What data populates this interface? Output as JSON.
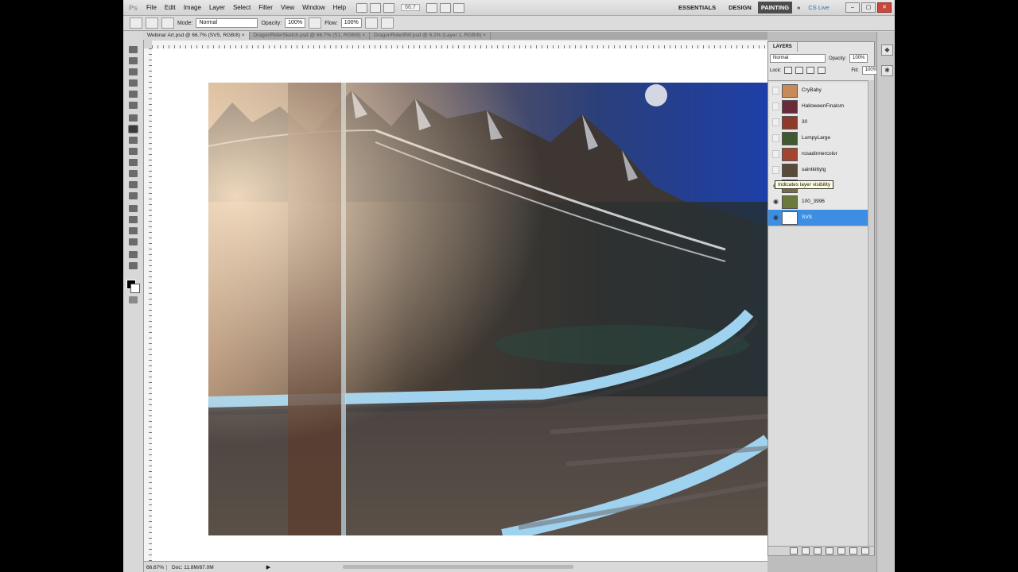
{
  "app": {
    "logo": "Ps"
  },
  "menubar": {
    "items": [
      "File",
      "Edit",
      "Image",
      "Layer",
      "Select",
      "Filter",
      "View",
      "Window",
      "Help"
    ],
    "zoom": "66.7",
    "workspaces": [
      "ESSENTIALS",
      "DESIGN",
      "PAINTING"
    ],
    "active_workspace": "PAINTING",
    "more": "»",
    "cs_live": "CS Live"
  },
  "options_bar": {
    "mode_label": "Mode:",
    "mode_value": "Normal",
    "opacity_label": "Opacity:",
    "opacity_value": "100%",
    "flow_label": "Flow:",
    "flow_value": "100%"
  },
  "tabs": [
    {
      "label": "Webinar Art.psd @ 66.7% (SVS, RGB/8) ×",
      "active": true
    },
    {
      "label": "DragonRiderSketch.psd @ 66.7% (S1, RGB/8) ×",
      "active": false
    },
    {
      "label": "DragonRiderBW.psd @ 6.2% (Layer 1, RGB/8) ×",
      "active": false
    }
  ],
  "status_bar": {
    "zoom": "66.67%",
    "doc": "Doc: 11.8M/87.0M",
    "arrow": "▶"
  },
  "layers_panel": {
    "title": "LAYERS",
    "blend_mode": "Normal",
    "opacity_label": "Opacity:",
    "opacity_value": "100%",
    "lock_label": "Lock:",
    "fill_label": "Fill:",
    "fill_value": "100%",
    "layers": [
      {
        "name": "CryBaby",
        "visible": false,
        "color": "#c98a5a"
      },
      {
        "name": "HalloweenFinalsm",
        "visible": false,
        "color": "#6b2a3a"
      },
      {
        "name": "30",
        "visible": false,
        "color": "#8e3a2a"
      },
      {
        "name": "LumpyLarge",
        "visible": false,
        "color": "#3e5a2e"
      },
      {
        "name": "rosadinnercolor",
        "visible": false,
        "color": "#a2442e"
      },
      {
        "name": "saintkittylg",
        "visible": false,
        "color": "#5a4a3a"
      },
      {
        "name": "",
        "visible": true,
        "color": "#7a6a4a"
      },
      {
        "name": "100_3996",
        "visible": true,
        "color": "#6a7a3a"
      },
      {
        "name": "SVS",
        "visible": true,
        "color": "#ffffff",
        "selected": true
      }
    ],
    "tooltip": "Indicates layer visibility"
  },
  "icons": {
    "eye": "eye-icon",
    "link": "link-layers-icon",
    "fx": "fx-icon",
    "mask": "mask-icon",
    "adjust": "adjustment-icon",
    "folder": "folder-icon",
    "new": "new-layer-icon",
    "trash": "trash-icon"
  },
  "colors": {
    "accent_selected": "#3c8ee3",
    "workspace_active": "#4d4d4d",
    "close_button": "#c9473c"
  }
}
